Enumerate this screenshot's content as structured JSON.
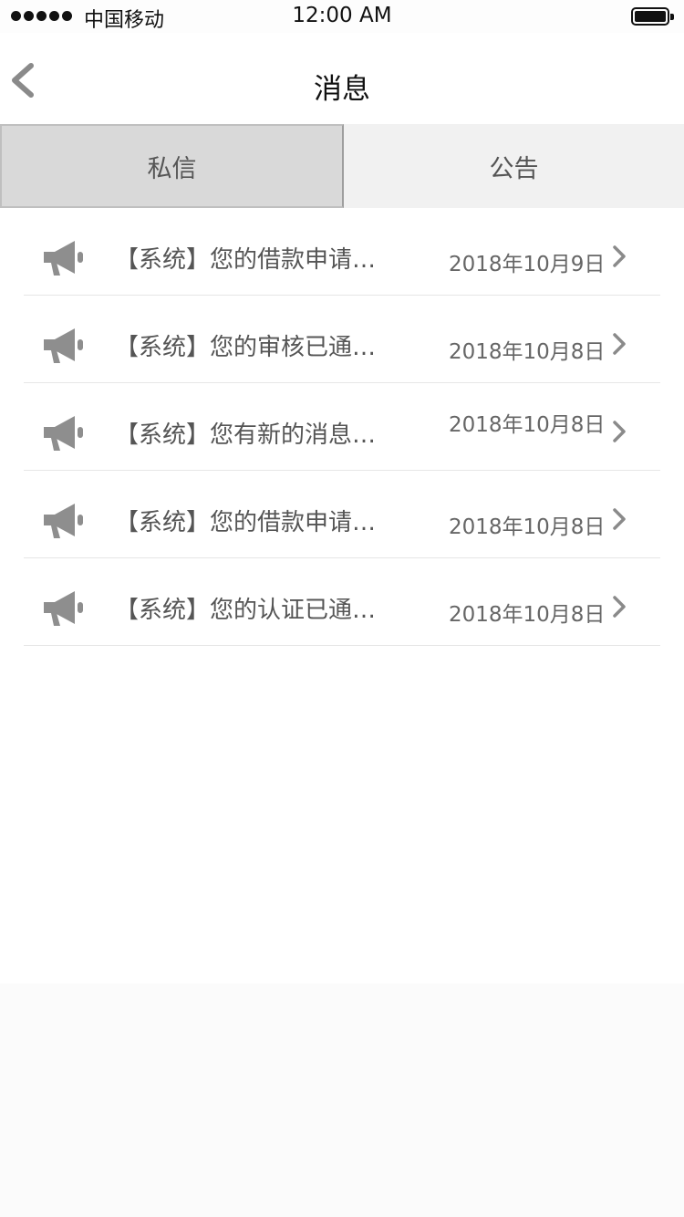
{
  "status_bar": {
    "carrier": "中国移动",
    "time": "12:00 AM"
  },
  "nav": {
    "title": "消息",
    "back_icon": "chevron-left-icon"
  },
  "tabs": [
    {
      "label": "私信",
      "active": true
    },
    {
      "label": "公告",
      "active": false
    }
  ],
  "messages": [
    {
      "text": "【系统】您的借款申请…",
      "date": "2018年10月9日",
      "icon": "megaphone-icon"
    },
    {
      "text": "【系统】您的审核已通…",
      "date": "2018年10月8日",
      "icon": "megaphone-icon"
    },
    {
      "text": "【系统】您有新的消息…",
      "date": "2018年10月8日",
      "icon": "megaphone-icon"
    },
    {
      "text": "【系统】您的借款申请…",
      "date": "2018年10月8日",
      "icon": "megaphone-icon"
    },
    {
      "text": "【系统】您的认证已通…",
      "date": "2018年10月8日",
      "icon": "megaphone-icon"
    }
  ],
  "colors": {
    "active_tab": "#d9d9d9",
    "inactive_tab": "#f1f1f1",
    "icon_gray": "#8e8e8e"
  }
}
